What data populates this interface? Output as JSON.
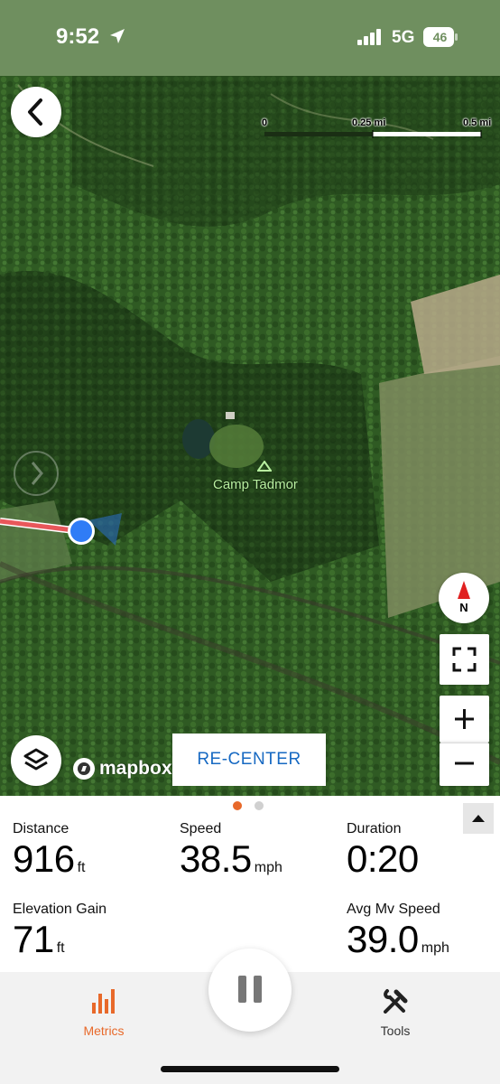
{
  "colors": {
    "accent": "#e8692a",
    "recenter_text": "#1769c2",
    "track": "#e8575a",
    "location_dot": "#2f7cf6",
    "dot_inactive": "#d0d0d0"
  },
  "status_bar": {
    "time": "9:52",
    "network": "5G",
    "battery": "46",
    "location_icon": "location-arrow-icon"
  },
  "map": {
    "scale": {
      "zero": "0",
      "mid": "0.25 mi",
      "end": "0.5 mi"
    },
    "poi": {
      "name": "Camp Tadmor",
      "icon": "triangle-icon"
    },
    "compass_letter": "N",
    "recenter_label": "RE-CENTER",
    "attribution": "mapbox"
  },
  "metrics": {
    "distance": {
      "label": "Distance",
      "value": "916",
      "unit": "ft"
    },
    "speed": {
      "label": "Speed",
      "value": "38.5",
      "unit": "mph"
    },
    "duration": {
      "label": "Duration",
      "value": "0:20",
      "unit": ""
    },
    "elevation_gain": {
      "label": "Elevation Gain",
      "value": "71",
      "unit": "ft"
    },
    "avg_moving_speed": {
      "label": "Avg Mv Speed",
      "value": "39.0",
      "unit": "mph"
    }
  },
  "pager": {
    "pages": 2,
    "active": 0
  },
  "tabs": [
    {
      "label": "Metrics",
      "icon": "bar-chart-icon",
      "active": true
    },
    {
      "label": "Tools",
      "icon": "tools-icon",
      "active": false
    }
  ]
}
